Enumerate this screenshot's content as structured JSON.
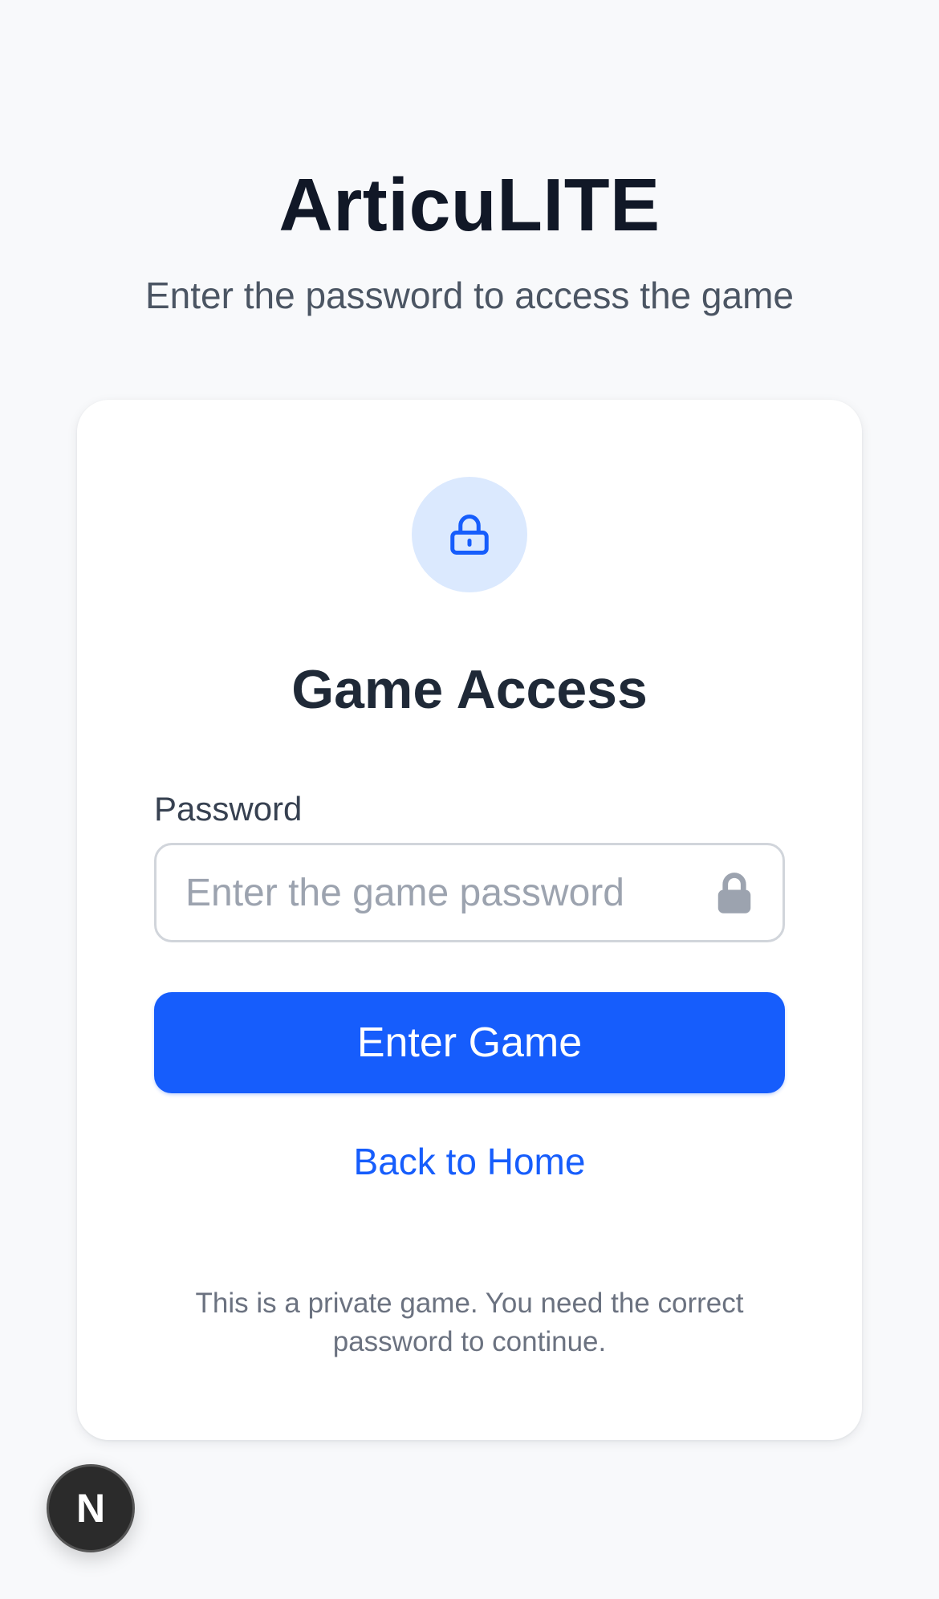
{
  "header": {
    "title": "ArticuLITE",
    "subtitle": "Enter the password to access the game"
  },
  "card": {
    "icon": "lock-icon",
    "title": "Game Access",
    "password_label": "Password",
    "password_placeholder": "Enter the game password",
    "password_value": "",
    "password_icon": "lock-icon",
    "submit_label": "Enter Game",
    "back_link_label": "Back to Home",
    "footnote": "This is a private game. You need the correct password to continue."
  },
  "dev_badge": {
    "label": "N"
  },
  "colors": {
    "accent": "#165dfc",
    "badge_bg": "#dbe9fe",
    "page_bg": "#f8f9fb"
  }
}
